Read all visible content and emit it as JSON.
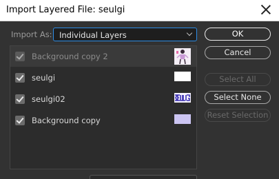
{
  "window": {
    "title": "Import Layered File: seulgi"
  },
  "import_as": {
    "label": "Import As:",
    "value": "Individual Layers"
  },
  "layers": [
    {
      "name": "Background copy 2",
      "checked": true,
      "thumbnail": "figure-thumbnail"
    },
    {
      "name": "seulgi",
      "checked": true,
      "thumbnail": "white-thumbnail"
    },
    {
      "name": "seulgi02",
      "checked": true,
      "thumbnail": "text-logo-thumbnail"
    },
    {
      "name": "Background copy",
      "checked": true,
      "thumbnail": "lavender-thumbnail"
    }
  ],
  "buttons": {
    "ok": "OK",
    "cancel": "Cancel",
    "select_all": "Select All",
    "select_none": "Select None",
    "reset_selection": "Reset Selection"
  }
}
